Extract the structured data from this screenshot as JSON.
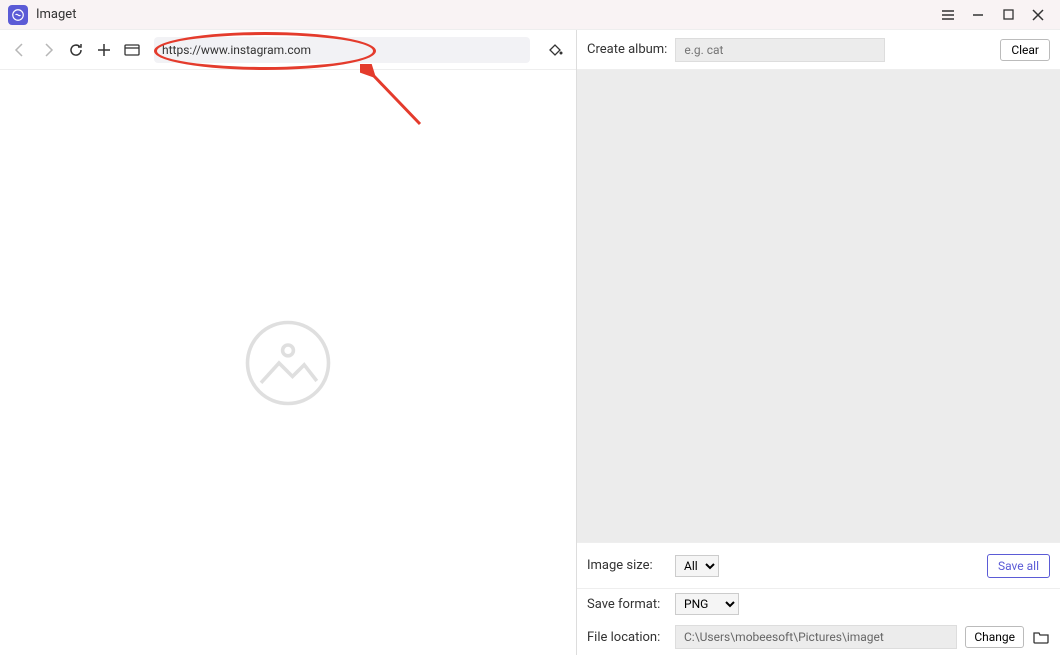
{
  "app": {
    "title": "Imaget"
  },
  "toolbar": {
    "url_value": "https://www.instagram.com"
  },
  "right": {
    "create_album_label": "Create album:",
    "album_placeholder": "e.g. cat",
    "clear_label": "Clear",
    "image_size_label": "Image size:",
    "image_size_value": "All",
    "save_all_label": "Save all",
    "save_format_label": "Save format:",
    "save_format_value": "PNG",
    "file_location_label": "File location:",
    "file_location_value": "C:\\Users\\mobeesoft\\Pictures\\imaget",
    "change_label": "Change"
  }
}
